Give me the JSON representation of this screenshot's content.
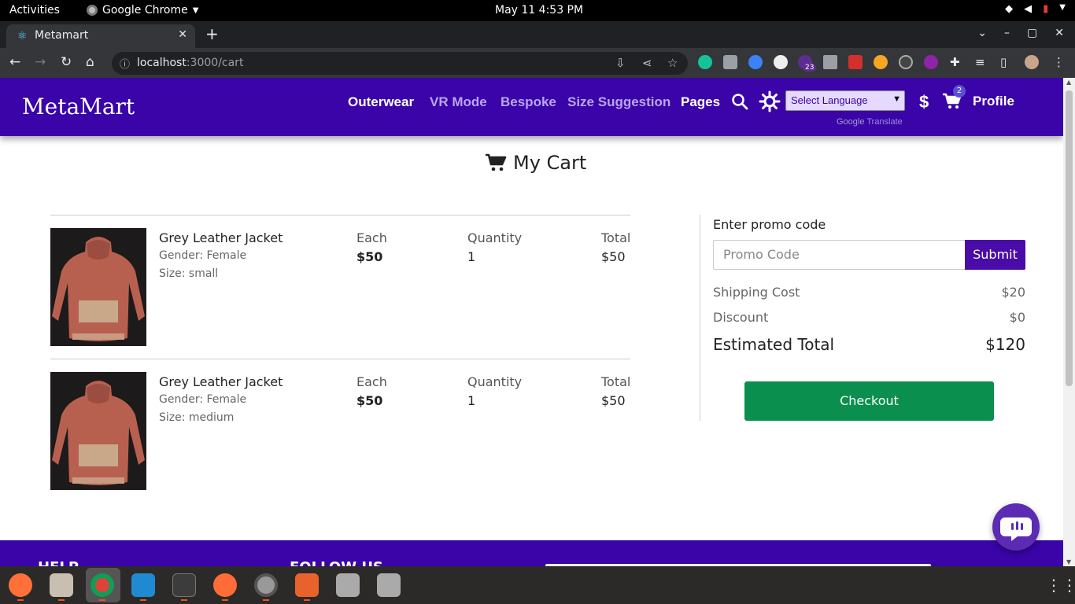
{
  "system_bar": {
    "activities": "Activities",
    "app_name": "Google Chrome",
    "datetime": "May 11   4:53 PM"
  },
  "browser": {
    "tab_title": "Metamart",
    "url_host": "localhost",
    "url_path": ":3000/cart",
    "extension_badge": "23"
  },
  "header": {
    "brand": "MetaMart",
    "nav": [
      "Outerwear",
      "VR Mode",
      "Bespoke",
      "Size Suggestion",
      "Pages"
    ],
    "language_select": "Select Language",
    "translate_brand": "Google",
    "translate_label": "Translate",
    "currency_symbol": "$",
    "cart_count": "2",
    "profile": "Profile"
  },
  "cart": {
    "title": "My Cart",
    "items": [
      {
        "name": "Grey Leather Jacket",
        "gender": "Gender: Female",
        "size": "Size: small",
        "each_label": "Each",
        "each": "$50",
        "qty_label": "Quantity",
        "qty": "1",
        "total_label": "Total",
        "total": "$50"
      },
      {
        "name": "Grey Leather Jacket",
        "gender": "Gender: Female",
        "size": "Size: medium",
        "each_label": "Each",
        "each": "$50",
        "qty_label": "Quantity",
        "qty": "1",
        "total_label": "Total",
        "total": "$50"
      }
    ]
  },
  "summary": {
    "promo_label": "Enter promo code",
    "promo_placeholder": "Promo Code",
    "submit": "Submit",
    "shipping_label": "Shipping Cost",
    "shipping_value": "$20",
    "discount_label": "Discount",
    "discount_value": "$0",
    "total_label": "Estimated Total",
    "total_value": "$120",
    "checkout": "Checkout"
  },
  "footer": {
    "help": "HELP",
    "follow": "FOLLOW US"
  },
  "colors": {
    "brand_purple": "#3a04a8",
    "checkout_green": "#0a8f4e"
  }
}
